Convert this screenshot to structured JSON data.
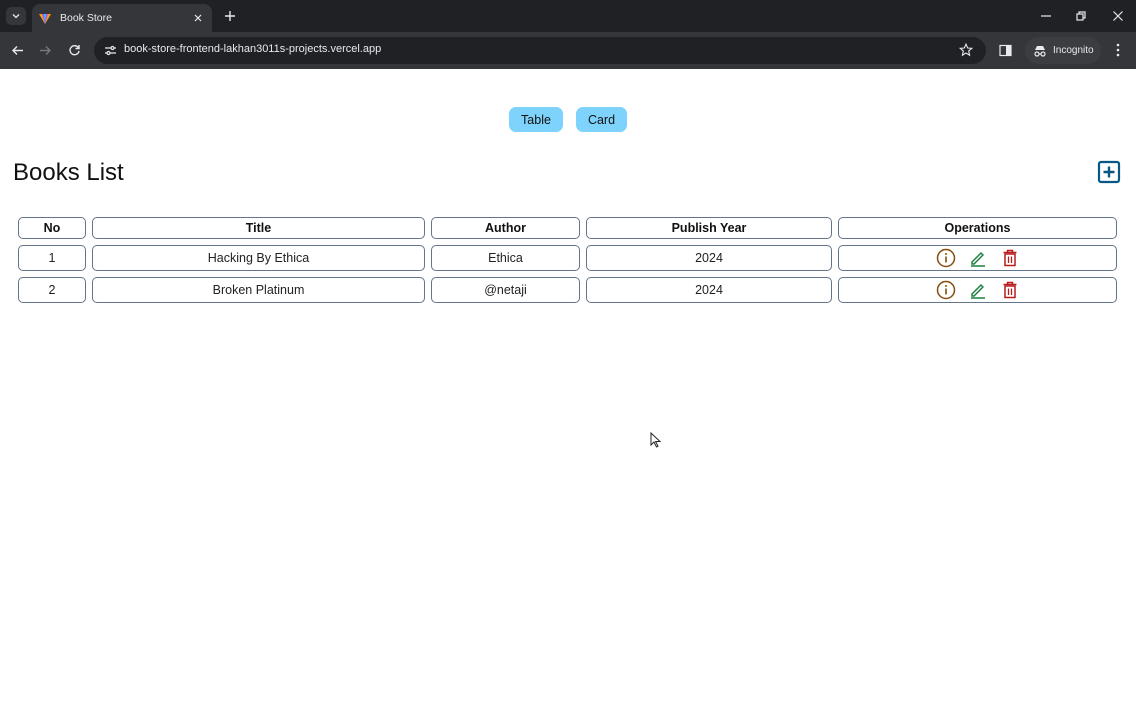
{
  "browser": {
    "tab_title": "Book Store",
    "url": "book-store-frontend-lakhan3011s-projects.vercel.app",
    "incognito_label": "Incognito"
  },
  "view_toggle": {
    "table_label": "Table",
    "card_label": "Card",
    "color": "#7dd3fc"
  },
  "page": {
    "title": "Books List",
    "add_icon": "plus-box-icon",
    "add_icon_color": "#075985"
  },
  "table": {
    "headers": [
      "No",
      "Title",
      "Author",
      "Publish Year",
      "Operations"
    ],
    "rows": [
      {
        "no": "1",
        "title": "Hacking By Ethica",
        "author": "Ethica",
        "year": "2024"
      },
      {
        "no": "2",
        "title": "Broken Platinum",
        "author": "@netaji",
        "year": "2024"
      }
    ],
    "operation_icons": [
      {
        "name": "info-circle-icon",
        "color": "#854d0e"
      },
      {
        "name": "edit-pencil-icon",
        "color": "#15803d"
      },
      {
        "name": "delete-trash-icon",
        "color": "#b91c1c"
      }
    ]
  }
}
